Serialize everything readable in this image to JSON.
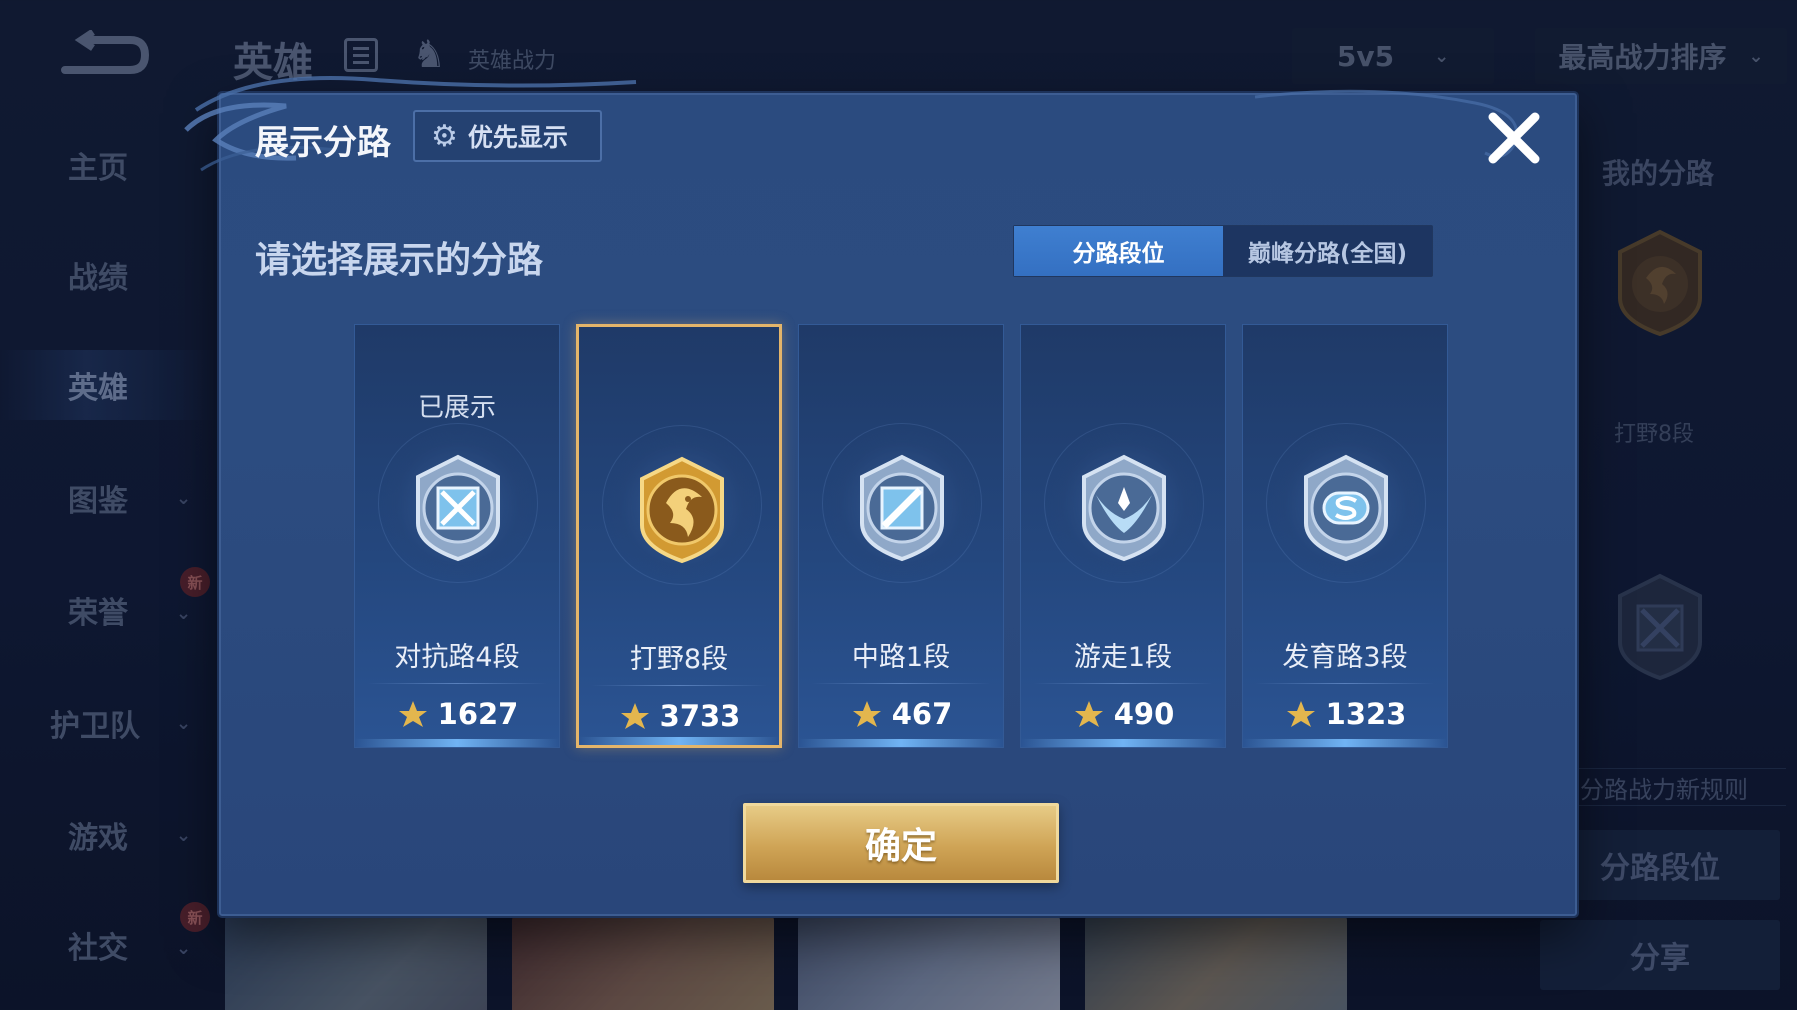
{
  "background": {
    "page_title": "英雄",
    "power_label": "英雄战力",
    "mode_select": "5v5",
    "sort_select": "最高战力排序",
    "nav": [
      {
        "label": "主页",
        "has_chevron": false,
        "badge": ""
      },
      {
        "label": "战绩",
        "has_chevron": false,
        "badge": ""
      },
      {
        "label": "英雄",
        "has_chevron": false,
        "badge": "",
        "active": true
      },
      {
        "label": "图鉴",
        "has_chevron": true,
        "badge": ""
      },
      {
        "label": "荣誉",
        "has_chevron": true,
        "badge": "新"
      },
      {
        "label": "护卫队",
        "has_chevron": true,
        "badge": ""
      },
      {
        "label": "游戏",
        "has_chevron": true,
        "badge": ""
      },
      {
        "label": "社交",
        "has_chevron": true,
        "badge": "新"
      }
    ],
    "right_panel": {
      "title": "我的分路",
      "lane_label": "打野8段",
      "rule_text": "分路战力新规则",
      "lane_rank_button": "分路段位",
      "share_button": "分享"
    }
  },
  "modal": {
    "title": "展示分路",
    "priority_button": "优先显示",
    "subtitle": "请选择展示的分路",
    "tabs": [
      {
        "label": "分路段位",
        "active": true
      },
      {
        "label": "巅峰分路(全国)",
        "active": false
      }
    ],
    "cards": [
      {
        "lane": "对抗路4段",
        "power": "1627",
        "shown_label": "已展示",
        "emblem": "clash-lane-emblem",
        "selected": false
      },
      {
        "lane": "打野8段",
        "power": "3733",
        "shown_label": "",
        "emblem": "jungle-emblem",
        "selected": true
      },
      {
        "lane": "中路1段",
        "power": "467",
        "shown_label": "",
        "emblem": "mid-lane-emblem",
        "selected": false
      },
      {
        "lane": "游走1段",
        "power": "490",
        "shown_label": "",
        "emblem": "roam-emblem",
        "selected": false
      },
      {
        "lane": "发育路3段",
        "power": "1323",
        "shown_label": "",
        "emblem": "farm-lane-emblem",
        "selected": false
      }
    ],
    "confirm_button": "确定"
  },
  "colors": {
    "modal_bg": "#2c4c80",
    "tab_active": "#3a78c9",
    "selected_border": "#e4b56a",
    "confirm_gold": "#cfa456"
  }
}
